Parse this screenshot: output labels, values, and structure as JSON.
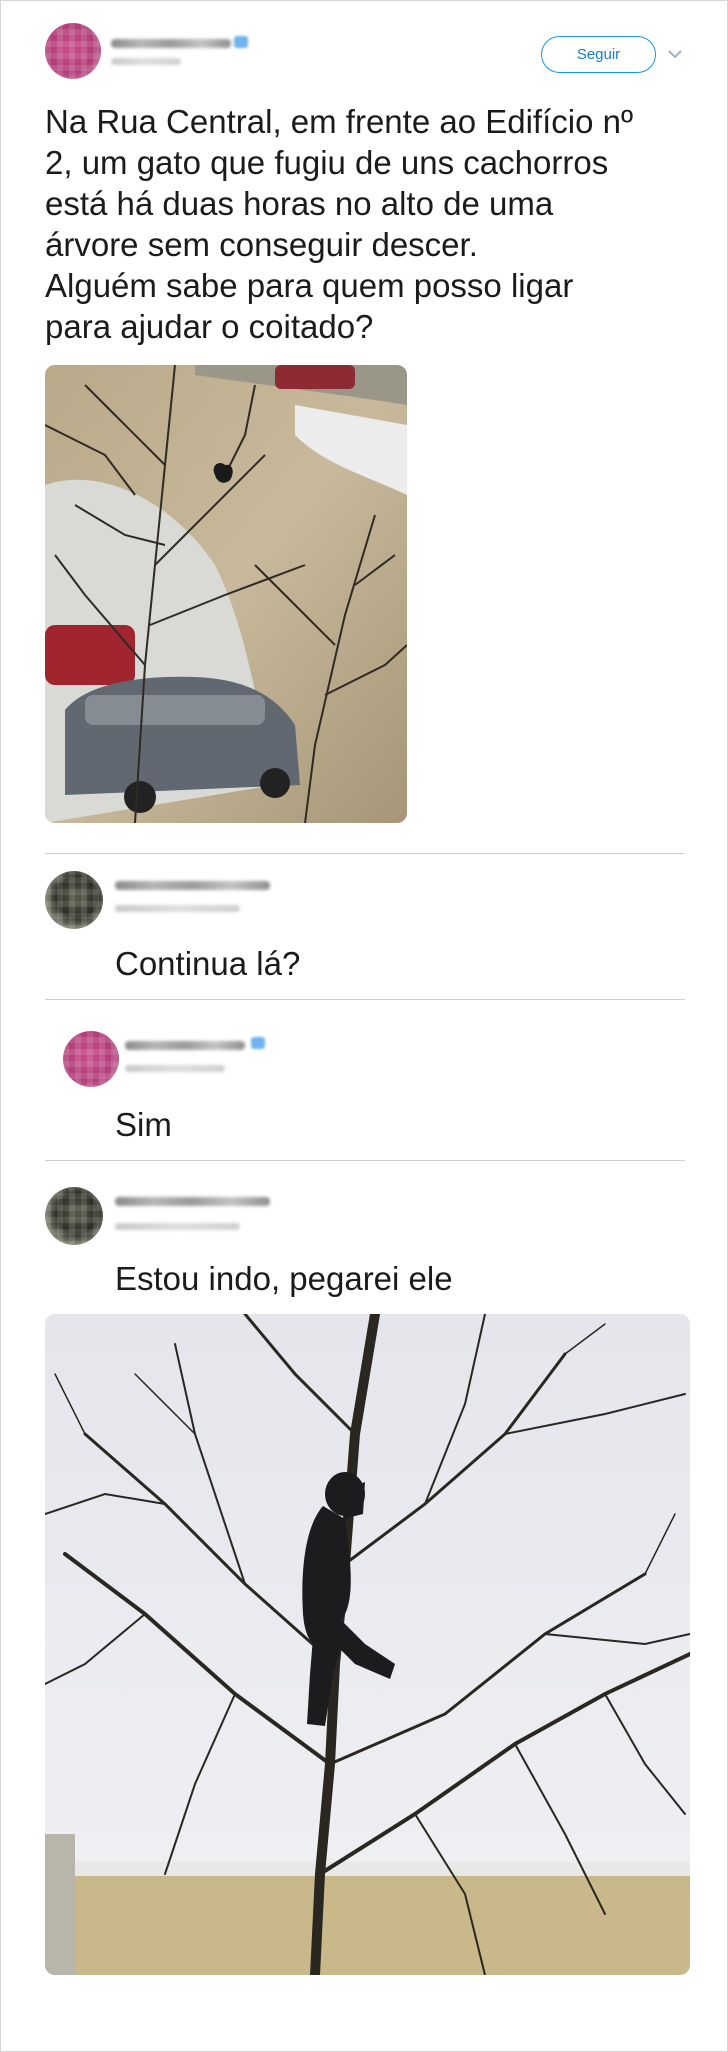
{
  "tweet": {
    "follow_label": "Seguir",
    "text": "Na Rua Central, em frente ao Edifício nº\n2, um gato que fugiu de uns cachorros\nestá há duas horas no alto de uma\nárvore sem conseguir descer.\nAlguém sabe para quem posso ligar\npara ajudar o coitado?"
  },
  "replies": [
    {
      "text": "Continua lá?"
    },
    {
      "text": "Sim"
    },
    {
      "text": "Estou indo, pegarei ele"
    }
  ],
  "icons": {
    "follow_menu": "chevron-down-icon",
    "verified": "verified-badge-icon"
  },
  "colors": {
    "accent": "#1c94e0",
    "text": "#1b1b1b",
    "divider": "#cfcfcf"
  }
}
